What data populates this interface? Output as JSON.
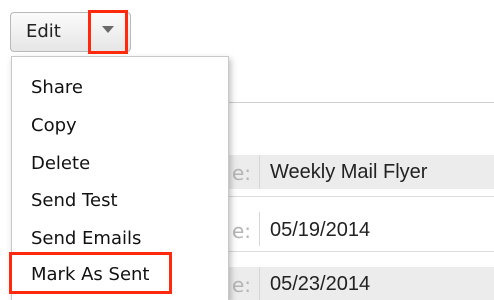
{
  "toolbar": {
    "edit_label": "Edit",
    "dropdown_icon": "chevron-down-icon"
  },
  "menu": {
    "items": [
      {
        "label": "Share"
      },
      {
        "label": "Copy"
      },
      {
        "label": "Delete"
      },
      {
        "label": "Send Test"
      },
      {
        "label": "Send Emails"
      },
      {
        "label": "Mark As Sent"
      }
    ],
    "highlighted": "Mark As Sent"
  },
  "details": {
    "rows": [
      {
        "label_suffix": "e:",
        "value": "Weekly Mail Flyer"
      },
      {
        "label_suffix": "e:",
        "value": "05/19/2014"
      },
      {
        "label_suffix": "e:",
        "value": "05/23/2014"
      }
    ]
  },
  "colors": {
    "highlight": "#ff2a0e",
    "row_stripe": "#ececec"
  }
}
